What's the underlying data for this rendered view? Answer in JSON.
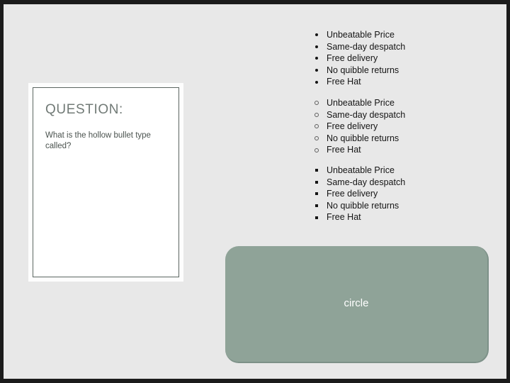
{
  "slide": {
    "background_color": "#e8e8e8",
    "frame_color": "#1b1b1b"
  },
  "question_panel": {
    "heading": "QUESTION:",
    "body": "What is the hollow bullet type called?",
    "panel_background": "#ffffff",
    "border_color": "#5b6661",
    "heading_color": "#717a76",
    "body_color": "#4b534f"
  },
  "bullet_groups": [
    {
      "marker_name": "filled-disc-bullet",
      "marker_style": "disc",
      "items": [
        "Unbeatable Price",
        "Same-day despatch",
        "Free delivery",
        "No quibble returns",
        "Free Hat"
      ]
    },
    {
      "marker_name": "hollow-circle-bullet",
      "marker_style": "circle",
      "items": [
        "Unbeatable Price",
        "Same-day despatch",
        "Free delivery",
        "No quibble returns",
        "Free Hat"
      ]
    },
    {
      "marker_name": "square-bullet",
      "marker_style": "square",
      "items": [
        "Unbeatable Price",
        "Same-day despatch",
        "Free delivery",
        "No quibble returns",
        "Free Hat"
      ]
    }
  ],
  "answer_box": {
    "text": "circle",
    "fill_color": "#8fa398",
    "edge_color": "#7d9188",
    "text_color": "#ffffff"
  }
}
